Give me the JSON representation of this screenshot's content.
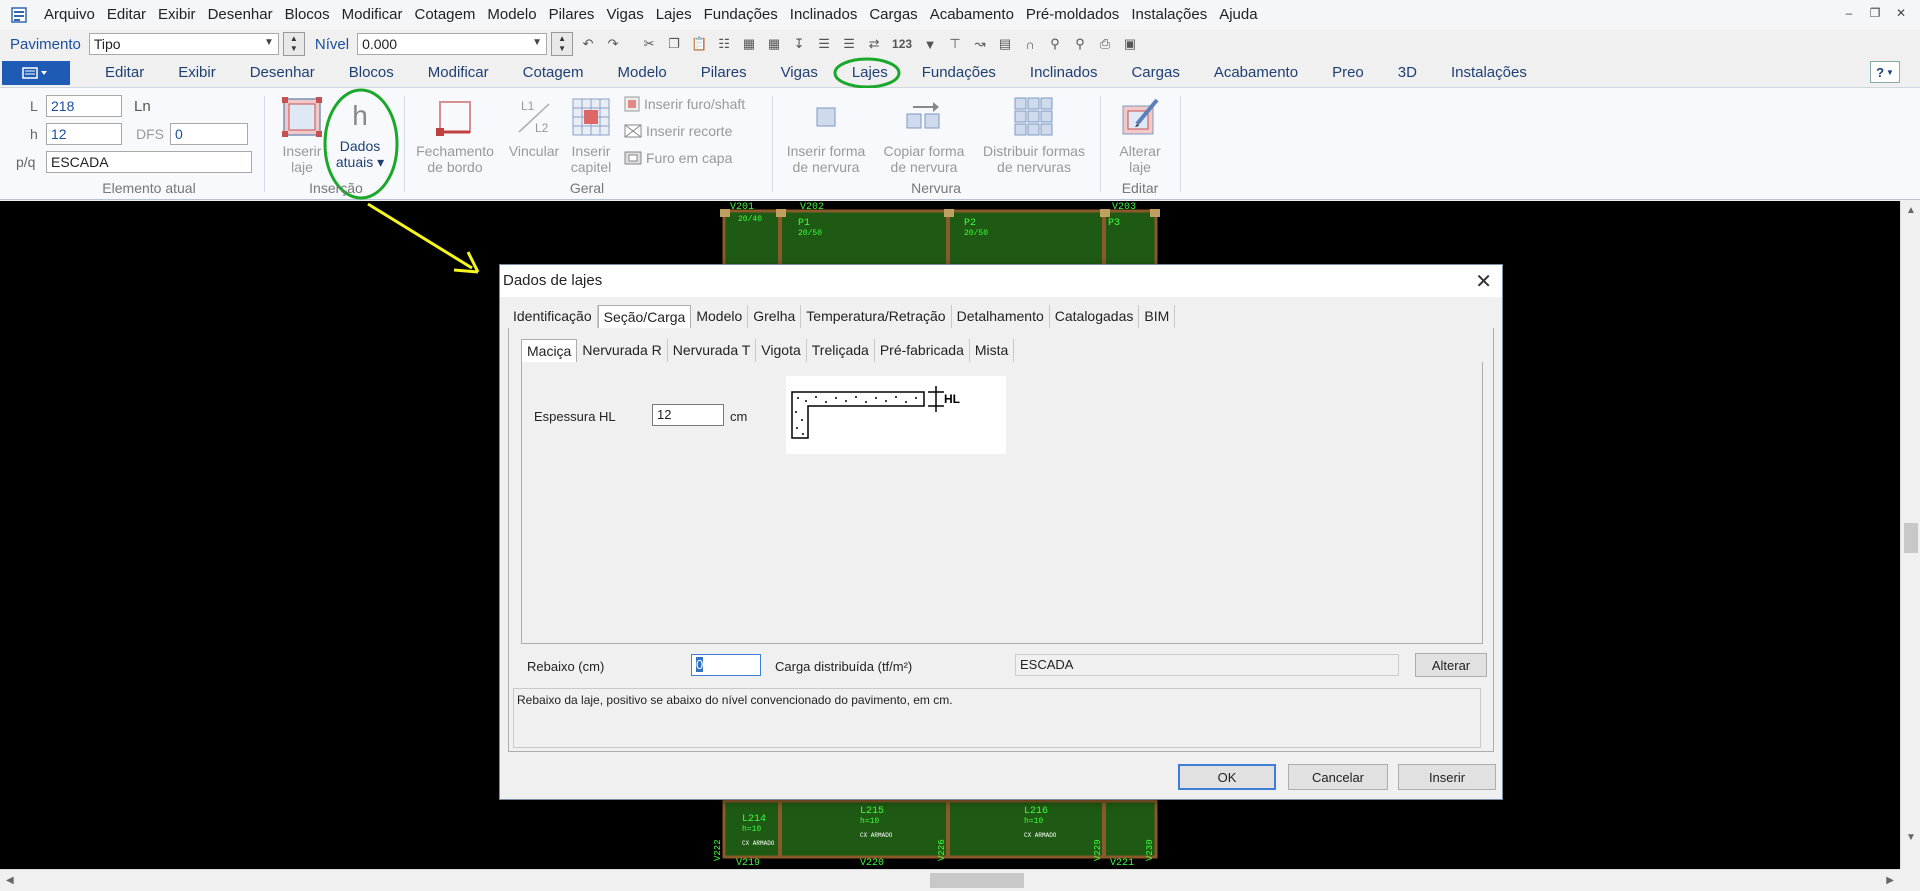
{
  "menubar": {
    "items": [
      "Arquivo",
      "Editar",
      "Exibir",
      "Desenhar",
      "Blocos",
      "Modificar",
      "Cotagem",
      "Modelo",
      "Pilares",
      "Vigas",
      "Lajes",
      "Fundações",
      "Inclinados",
      "Cargas",
      "Acabamento",
      "Pré-moldados",
      "Instalações",
      "Ajuda"
    ]
  },
  "toolbar": {
    "pavimento_label": "Pavimento",
    "pavimento_value": "Tipo",
    "nivel_label": "Nível",
    "nivel_value": "0.000",
    "icon_123": "123"
  },
  "ribbon_tabs": [
    "Editar",
    "Exibir",
    "Desenhar",
    "Blocos",
    "Modificar",
    "Cotagem",
    "Modelo",
    "Pilares",
    "Vigas",
    "Lajes",
    "Fundações",
    "Inclinados",
    "Cargas",
    "Acabamento",
    "Preo",
    "3D",
    "Instalações"
  ],
  "help_label": "?",
  "ribbon": {
    "elemento_atual": {
      "L_label": "L",
      "L_value": "218",
      "Ln_label": "Ln",
      "h_label": "h",
      "h_value": "12",
      "dfs_label": "DFS",
      "dfs_value": "0",
      "pq_label": "p/q",
      "pq_value": "ESCADA",
      "group_label": "Elemento atual"
    },
    "insercao": {
      "inserir_laje": "Inserir laje",
      "dados_atuais_line1": "Dados",
      "dados_atuais_line2": "atuais ▾",
      "dados_atuais_icon": "h",
      "group_label": "Inserção"
    },
    "geral": {
      "fechamento_line1": "Fechamento",
      "fechamento_line2": "de bordo",
      "vincular": "Vincular",
      "inserir_capitel_line1": "Inserir",
      "inserir_capitel_line2": "capitel",
      "inserir_furo": "Inserir furo/shaft",
      "inserir_recorte": "Inserir recorte",
      "furo_capa": "Furo em capa",
      "group_label": "Geral"
    },
    "nervura": {
      "inserir_forma_line1": "Inserir forma",
      "inserir_forma_line2": "de nervura",
      "copiar_forma_line1": "Copiar forma",
      "copiar_forma_line2": "de nervura",
      "distribuir_line1": "Distribuir formas",
      "distribuir_line2": "de nervuras",
      "group_label": "Nervura"
    },
    "editar": {
      "alterar_line1": "Alterar",
      "alterar_line2": "laje",
      "group_label": "Editar"
    }
  },
  "canvas": {
    "labels": [
      "V201",
      "V202",
      "V203",
      "P1",
      "P2",
      "P3",
      "20/40",
      "20/50",
      "20/50",
      "L215",
      "L216",
      "L214",
      "V219",
      "V220",
      "V221",
      "V222",
      "V226",
      "V229",
      "V230",
      "h=10",
      "h=10",
      "h=10",
      "CX ARMADO",
      "CX ARMADO",
      "CX ARMADO"
    ]
  },
  "dialog": {
    "title": "Dados de lajes",
    "tabs": [
      "Identificação",
      "Seção/Carga",
      "Modelo",
      "Grelha",
      "Temperatura/Retração",
      "Detalhamento",
      "Catalogadas",
      "BIM"
    ],
    "subtabs": [
      "Maciça",
      "Nervurada R",
      "Nervurada T",
      "Vigota",
      "Treliçada",
      "Pré-fabricada",
      "Mista"
    ],
    "espessura_label": "Espessura HL",
    "espessura_value": "12",
    "espessura_unit": "cm",
    "diagram_label": "HL",
    "rebaixo_label": "Rebaixo (cm)",
    "rebaixo_value": "0",
    "carga_label": "Carga distribuída (tf/m²)",
    "carga_value": "ESCADA",
    "alterar_btn": "Alterar",
    "help_text": "Rebaixo da laje, positivo se abaixo do nível convencionado do pavimento, em cm.",
    "ok_btn": "OK",
    "cancel_btn": "Cancelar",
    "inserir_btn": "Inserir"
  },
  "colors": {
    "accent_blue": "#1e5bb5",
    "annotation_green": "#1aa82b",
    "annotation_yellow": "#f5f520",
    "cad_slab_green": "#1f5a14",
    "cad_text_green": "#3bff3b",
    "cad_beam_brown": "#8a5a2a"
  }
}
